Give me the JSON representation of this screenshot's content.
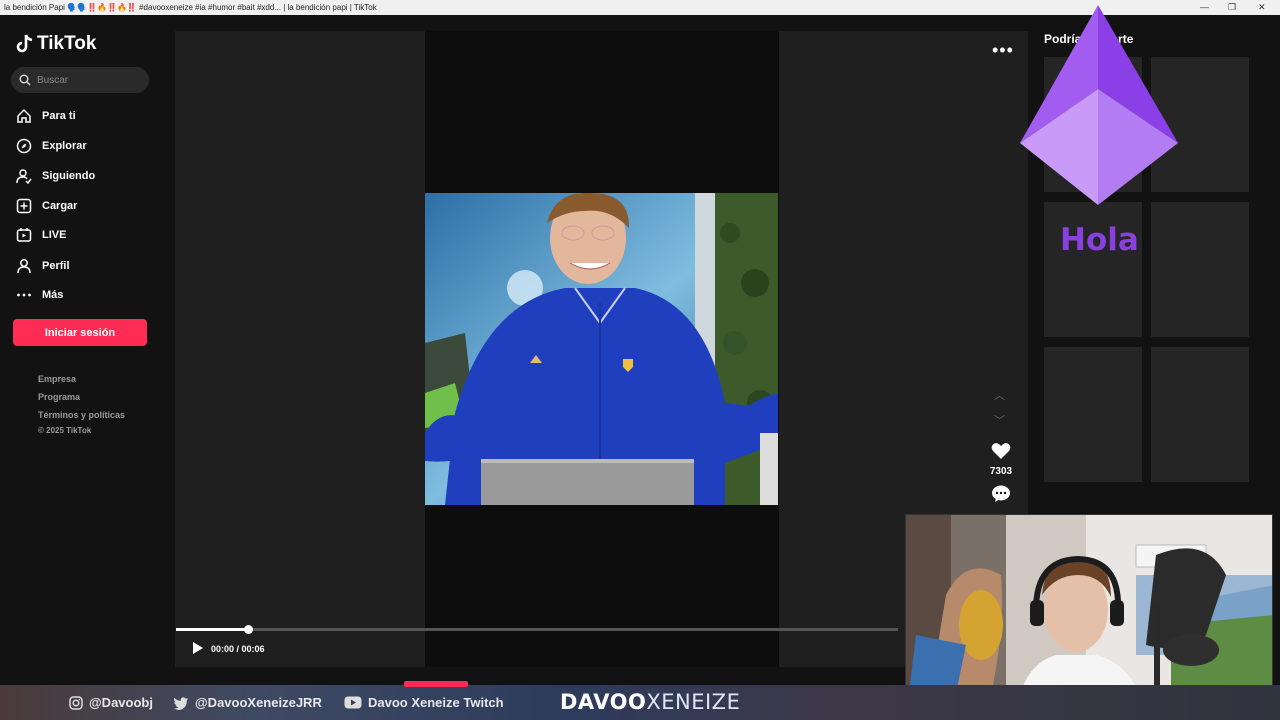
{
  "window": {
    "title": "la bendición Papi 🗣️🗣️‼️🔥‼️🔥‼️ #davooxeneize #ia #humor #bait #xdd... | la bendición papi | TikTok",
    "controls": [
      "—",
      "❐",
      "✕"
    ]
  },
  "brand": {
    "name": "TikTok"
  },
  "search": {
    "placeholder": "Buscar"
  },
  "nav": [
    {
      "label": "Para ti",
      "icon": "home-icon"
    },
    {
      "label": "Explorar",
      "icon": "compass-icon"
    },
    {
      "label": "Siguiendo",
      "icon": "following-icon"
    },
    {
      "label": "Cargar",
      "icon": "upload-icon"
    },
    {
      "label": "LIVE",
      "icon": "live-icon"
    },
    {
      "label": "Perfil",
      "icon": "profile-icon"
    },
    {
      "label": "Más",
      "icon": "more-icon"
    }
  ],
  "login_button": "Iniciar sesión",
  "footer": {
    "links": [
      "Empresa",
      "Programa",
      "Términos y políticas"
    ],
    "copyright": "© 2025 TikTok"
  },
  "player": {
    "likes": "7303",
    "time": "00:00 / 00:06",
    "progress": 0.1
  },
  "suggestions": {
    "title": "Podrías ... sarte"
  },
  "overlay": {
    "text": "Hola"
  },
  "stream": {
    "instagram": "@Davoobj",
    "twitter": "@DavooXeneizeJRR",
    "youtube": "Davoo Xeneize Twitch",
    "brand_bold": "DAVOO",
    "brand_light": "XENEIZE"
  },
  "colors": {
    "accent": "#fe2c55",
    "overlay_purple": "#8a3fe0"
  }
}
